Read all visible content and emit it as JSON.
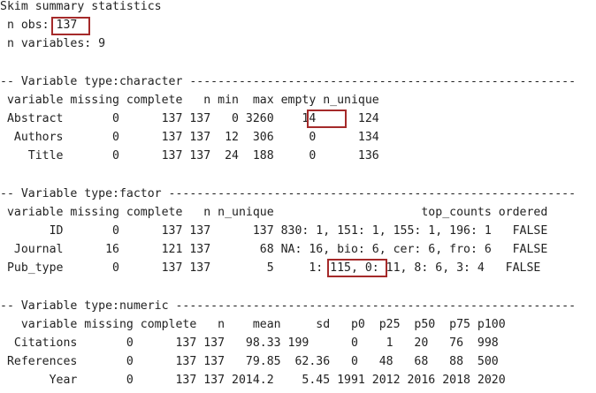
{
  "header": {
    "title": "Skim summary statistics",
    "n_obs_label": " n obs: ",
    "n_obs_value": "137",
    "n_variables": " n variables: 9"
  },
  "character_section": {
    "heading": "-- Variable type:character -------------------------------------------------------",
    "header": " variable missing complete   n min  max empty n_unique",
    "rows": [
      " Abstract       0      137 137   0 3260    14      124",
      "  Authors       0      137 137  12  306     0      134",
      "    Title       0      137 137  24  188     0      136"
    ]
  },
  "factor_section": {
    "heading": "-- Variable type:factor ----------------------------------------------------------",
    "header": " variable missing complete   n n_unique                     top_counts ordered",
    "rows": [
      "       ID       0      137 137      137 830: 1, 151: 1, 155: 1, 196: 1   FALSE",
      "  Journal      16      121 137       68 NA: 16, bio: 6, cer: 6, fro: 6   FALSE",
      " Pub_type       0      137 137        5     1: 115, 0: 11, 8: 6, 3: 4   FALSE"
    ]
  },
  "numeric_section": {
    "heading": "-- Variable type:numeric ---------------------------------------------------------",
    "header": "   variable missing complete   n    mean     sd   p0  p25  p50  p75 p100",
    "rows": [
      "  Citations       0      137 137   98.33 199      0    1   20   76  998",
      " References       0      137 137   79.85  62.36   0   48   68   88  500",
      "       Year       0      137 137 2014.2    5.45 1991 2012 2016 2018 2020"
    ]
  },
  "colors": {
    "text": "#222222",
    "highlight": "#a52a2a",
    "background": "#ffffff"
  }
}
